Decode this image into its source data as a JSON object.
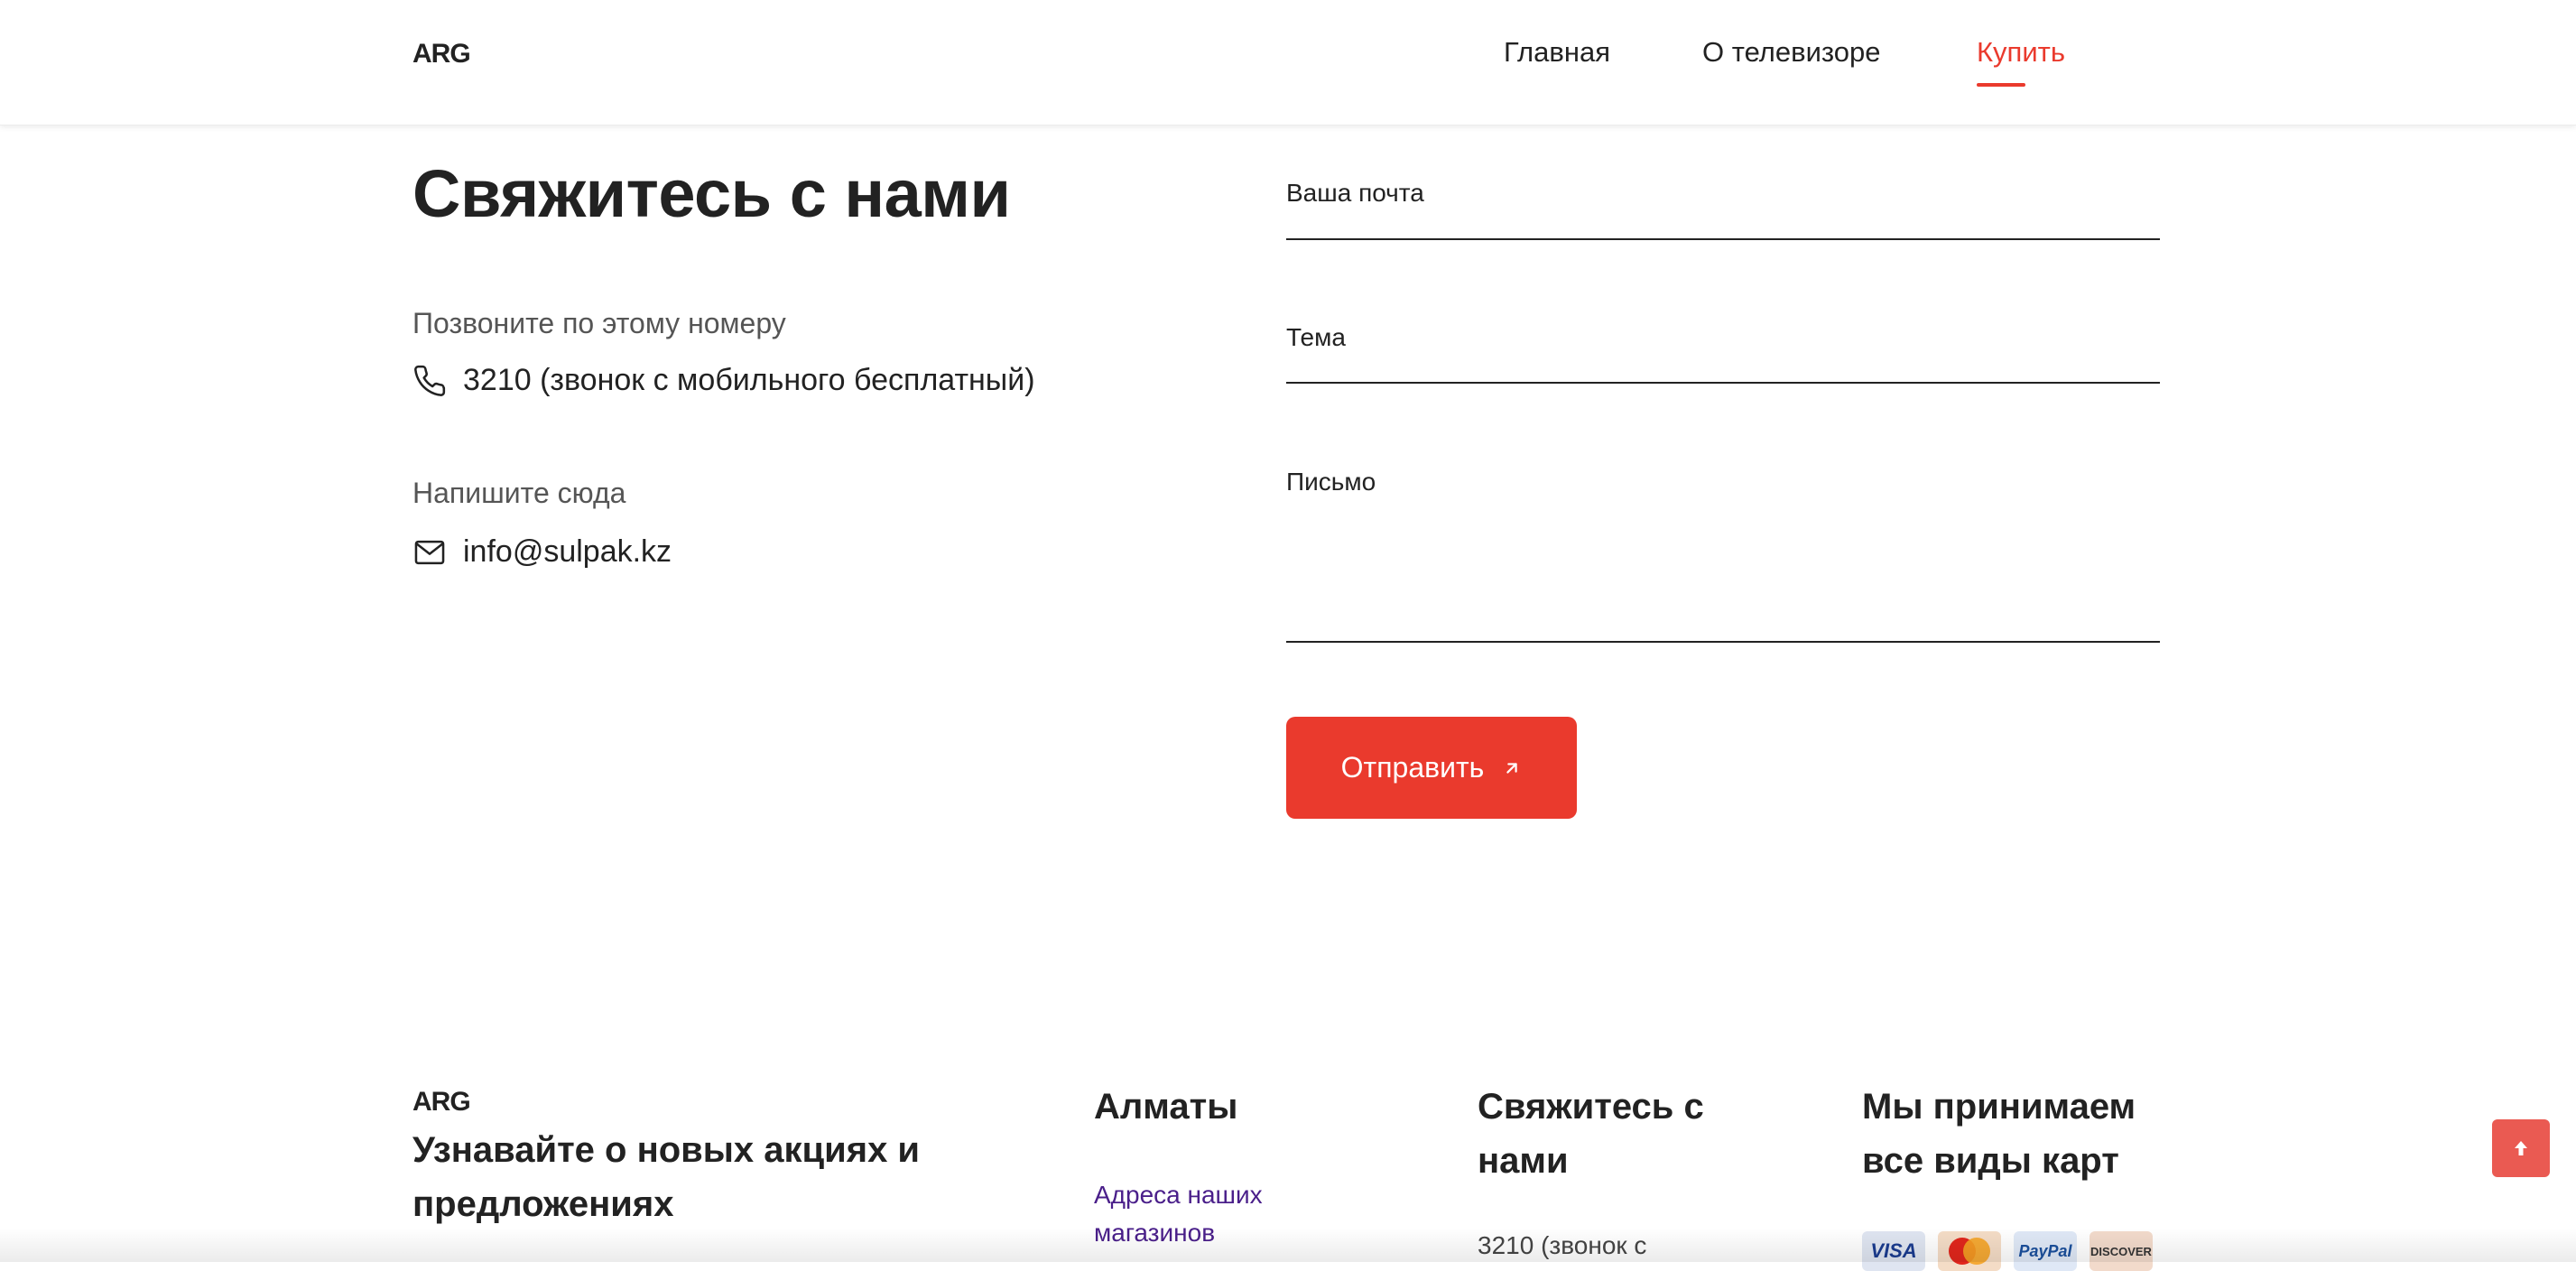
{
  "header": {
    "logo": "ARG",
    "nav": [
      {
        "label": "Главная",
        "active": false
      },
      {
        "label": "О телевизоре",
        "active": false
      },
      {
        "label": "Купить",
        "active": true
      }
    ]
  },
  "contact": {
    "title": "Свяжитесь с нами",
    "phone_label": "Позвоните по этому номеру",
    "phone_value": "3210 (звонок с мобильного бесплатный)",
    "email_label": "Напишите сюда",
    "email_value": "info@sulpak.kz",
    "icons": [
      "phone-icon",
      "mail-icon"
    ]
  },
  "form": {
    "email_label": "Ваша почта",
    "subject_label": "Тема",
    "message_label": "Письмо",
    "submit_label": "Отправить"
  },
  "footer": {
    "logo": "ARG",
    "subscribe_heading": "Узнавайте о новых акциях и предложениях",
    "city_heading": "Алматы",
    "stores_link": "Адреса наших магазинов",
    "contact_heading": "Свяжитесь с нами",
    "contact_phone_partial": "3210 (звонок с",
    "cards_heading": "Мы принимаем все виды карт",
    "cards": [
      "VISA",
      "PayPal",
      "DISCOVER"
    ]
  },
  "colors": {
    "accent": "#ea3a2d",
    "text": "#222222",
    "muted": "#555555",
    "link": "#4a1f8a"
  }
}
